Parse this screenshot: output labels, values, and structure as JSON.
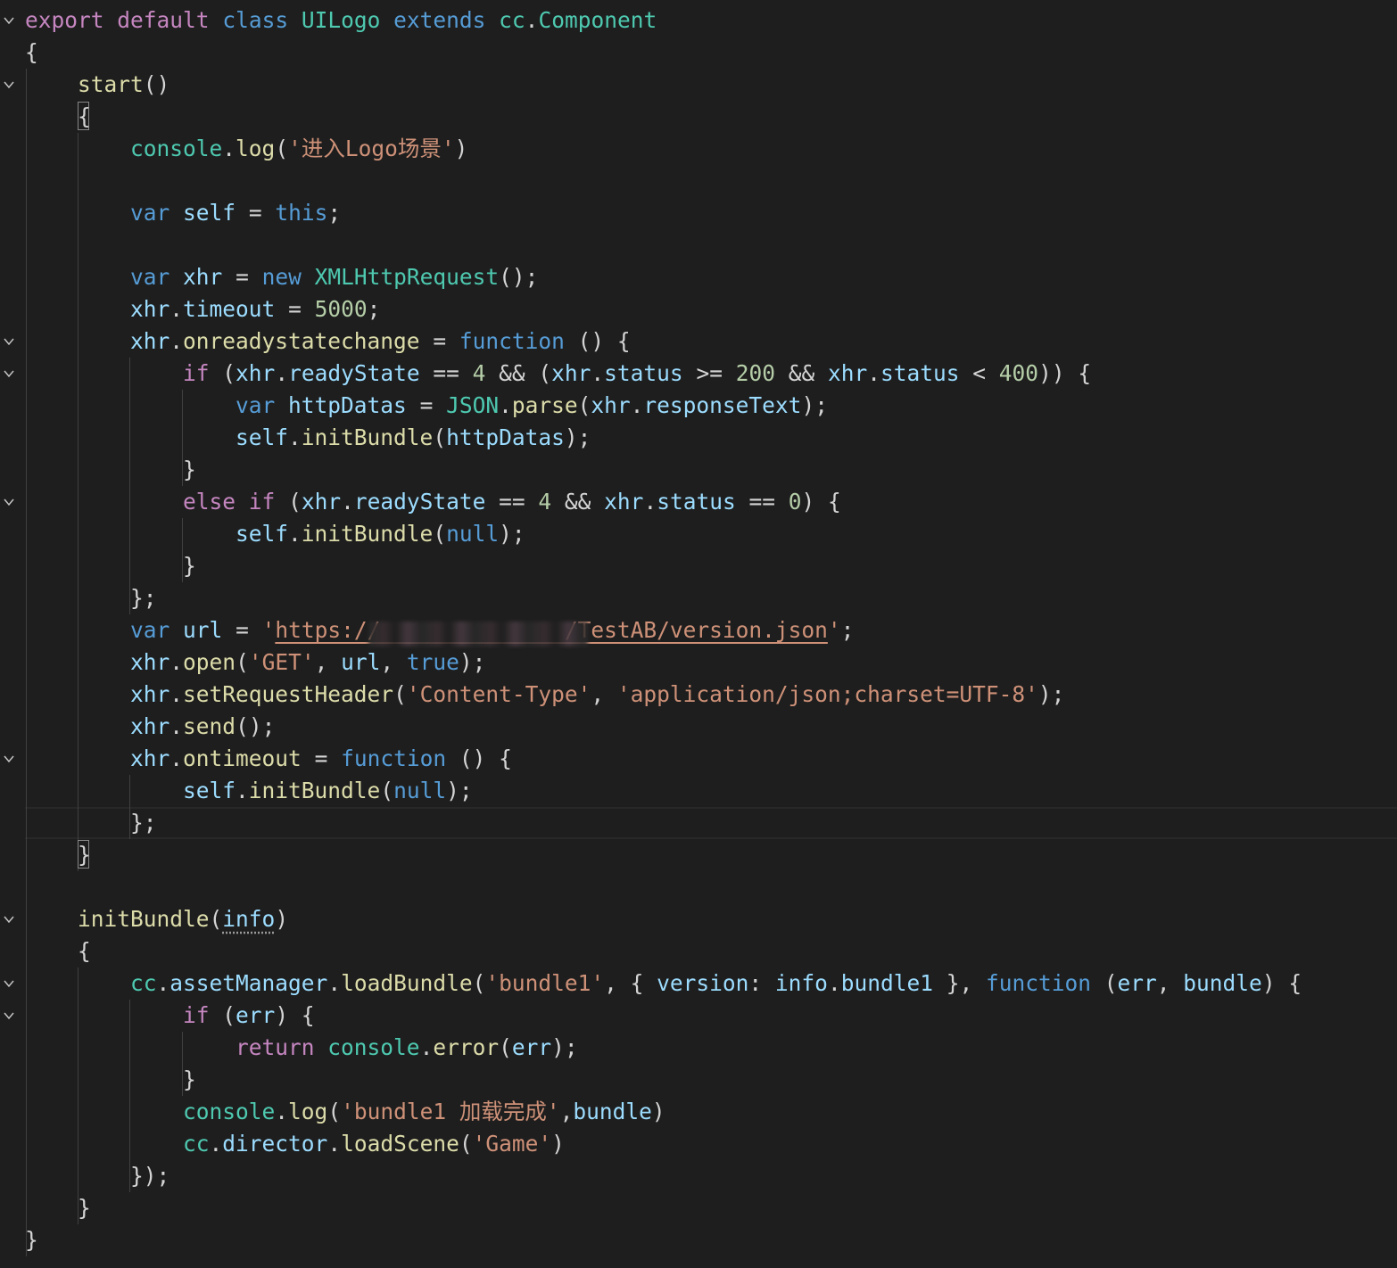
{
  "editor": {
    "background": "#1e1e1e",
    "redacted_region": "https:// host",
    "lines": [
      {
        "n": 1,
        "fold": true,
        "tokens": [
          [
            "export",
            "kw"
          ],
          [
            " ",
            "p"
          ],
          [
            "default",
            "kw"
          ],
          [
            " ",
            "p"
          ],
          [
            "class",
            "st"
          ],
          [
            " ",
            "p"
          ],
          [
            "UILogo",
            "cls"
          ],
          [
            " ",
            "p"
          ],
          [
            "extends",
            "st"
          ],
          [
            " ",
            "p"
          ],
          [
            "cc",
            "cls"
          ],
          [
            ".",
            "p"
          ],
          [
            "Component",
            "cls"
          ]
        ]
      },
      {
        "n": 2,
        "fold": false,
        "tokens": [
          [
            "{",
            "p"
          ]
        ]
      },
      {
        "n": 3,
        "fold": true,
        "tokens": [
          [
            "    ",
            "p"
          ],
          [
            "start",
            "fn"
          ],
          [
            "()",
            "p"
          ]
        ]
      },
      {
        "n": 4,
        "fold": false,
        "tokens": [
          [
            "    ",
            "p"
          ],
          [
            "{",
            "p"
          ]
        ]
      },
      {
        "n": 5,
        "fold": false,
        "tokens": [
          [
            "        ",
            "p"
          ],
          [
            "console",
            "cls"
          ],
          [
            ".",
            "p"
          ],
          [
            "log",
            "fn"
          ],
          [
            "(",
            "p"
          ],
          [
            "'进入Logo场景'",
            "str"
          ],
          [
            ")",
            "p"
          ]
        ]
      },
      {
        "n": 6,
        "fold": false,
        "tokens": []
      },
      {
        "n": 7,
        "fold": false,
        "tokens": [
          [
            "        ",
            "p"
          ],
          [
            "var",
            "st"
          ],
          [
            " ",
            "p"
          ],
          [
            "self",
            "var"
          ],
          [
            " = ",
            "p"
          ],
          [
            "this",
            "st"
          ],
          [
            ";",
            "p"
          ]
        ]
      },
      {
        "n": 8,
        "fold": false,
        "tokens": []
      },
      {
        "n": 9,
        "fold": false,
        "tokens": [
          [
            "        ",
            "p"
          ],
          [
            "var",
            "st"
          ],
          [
            " ",
            "p"
          ],
          [
            "xhr",
            "var"
          ],
          [
            " = ",
            "p"
          ],
          [
            "new",
            "st"
          ],
          [
            " ",
            "p"
          ],
          [
            "XMLHttpRequest",
            "cls"
          ],
          [
            "();",
            "p"
          ]
        ]
      },
      {
        "n": 10,
        "fold": false,
        "tokens": [
          [
            "        ",
            "p"
          ],
          [
            "xhr",
            "var"
          ],
          [
            ".",
            "p"
          ],
          [
            "timeout",
            "var"
          ],
          [
            " = ",
            "p"
          ],
          [
            "5000",
            "num"
          ],
          [
            ";",
            "p"
          ]
        ]
      },
      {
        "n": 11,
        "fold": true,
        "tokens": [
          [
            "        ",
            "p"
          ],
          [
            "xhr",
            "var"
          ],
          [
            ".",
            "p"
          ],
          [
            "onreadystatechange",
            "fn"
          ],
          [
            " = ",
            "p"
          ],
          [
            "function",
            "st"
          ],
          [
            " () {",
            "p"
          ]
        ]
      },
      {
        "n": 12,
        "fold": true,
        "tokens": [
          [
            "            ",
            "p"
          ],
          [
            "if",
            "kw"
          ],
          [
            " (",
            "p"
          ],
          [
            "xhr",
            "var"
          ],
          [
            ".",
            "p"
          ],
          [
            "readyState",
            "var"
          ],
          [
            " == ",
            "p"
          ],
          [
            "4",
            "num"
          ],
          [
            " && (",
            "p"
          ],
          [
            "xhr",
            "var"
          ],
          [
            ".",
            "p"
          ],
          [
            "status",
            "var"
          ],
          [
            " >= ",
            "p"
          ],
          [
            "200",
            "num"
          ],
          [
            " && ",
            "p"
          ],
          [
            "xhr",
            "var"
          ],
          [
            ".",
            "p"
          ],
          [
            "status",
            "var"
          ],
          [
            " < ",
            "p"
          ],
          [
            "400",
            "num"
          ],
          [
            ")) {",
            "p"
          ]
        ]
      },
      {
        "n": 13,
        "fold": false,
        "tokens": [
          [
            "                ",
            "p"
          ],
          [
            "var",
            "st"
          ],
          [
            " ",
            "p"
          ],
          [
            "httpDatas",
            "var"
          ],
          [
            " = ",
            "p"
          ],
          [
            "JSON",
            "cls"
          ],
          [
            ".",
            "p"
          ],
          [
            "parse",
            "fn"
          ],
          [
            "(",
            "p"
          ],
          [
            "xhr",
            "var"
          ],
          [
            ".",
            "p"
          ],
          [
            "responseText",
            "var"
          ],
          [
            ");",
            "p"
          ]
        ]
      },
      {
        "n": 14,
        "fold": false,
        "tokens": [
          [
            "                ",
            "p"
          ],
          [
            "self",
            "var"
          ],
          [
            ".",
            "p"
          ],
          [
            "initBundle",
            "fn"
          ],
          [
            "(",
            "p"
          ],
          [
            "httpDatas",
            "var"
          ],
          [
            ");",
            "p"
          ]
        ]
      },
      {
        "n": 15,
        "fold": false,
        "tokens": [
          [
            "            ",
            "p"
          ],
          [
            "}",
            "p"
          ]
        ]
      },
      {
        "n": 16,
        "fold": true,
        "tokens": [
          [
            "            ",
            "p"
          ],
          [
            "else",
            "kw"
          ],
          [
            " ",
            "p"
          ],
          [
            "if",
            "kw"
          ],
          [
            " (",
            "p"
          ],
          [
            "xhr",
            "var"
          ],
          [
            ".",
            "p"
          ],
          [
            "readyState",
            "var"
          ],
          [
            " == ",
            "p"
          ],
          [
            "4",
            "num"
          ],
          [
            " && ",
            "p"
          ],
          [
            "xhr",
            "var"
          ],
          [
            ".",
            "p"
          ],
          [
            "status",
            "var"
          ],
          [
            " == ",
            "p"
          ],
          [
            "0",
            "num"
          ],
          [
            ") {",
            "p"
          ]
        ]
      },
      {
        "n": 17,
        "fold": false,
        "tokens": [
          [
            "                ",
            "p"
          ],
          [
            "self",
            "var"
          ],
          [
            ".",
            "p"
          ],
          [
            "initBundle",
            "fn"
          ],
          [
            "(",
            "p"
          ],
          [
            "null",
            "st"
          ],
          [
            ");",
            "p"
          ]
        ]
      },
      {
        "n": 18,
        "fold": false,
        "tokens": [
          [
            "            ",
            "p"
          ],
          [
            "}",
            "p"
          ]
        ]
      },
      {
        "n": 19,
        "fold": false,
        "tokens": [
          [
            "        ",
            "p"
          ],
          [
            "};",
            "p"
          ]
        ]
      },
      {
        "n": 20,
        "fold": false,
        "tokens": [
          [
            "        ",
            "p"
          ],
          [
            "var",
            "st"
          ],
          [
            " ",
            "p"
          ],
          [
            "url",
            "var"
          ],
          [
            " = ",
            "p"
          ],
          [
            "'",
            "str"
          ],
          [
            "https://              ",
            "url"
          ],
          [
            "/TestAB/version.json",
            "url"
          ],
          [
            "'",
            "str"
          ],
          [
            ";",
            "p"
          ]
        ]
      },
      {
        "n": 21,
        "fold": false,
        "tokens": [
          [
            "        ",
            "p"
          ],
          [
            "xhr",
            "var"
          ],
          [
            ".",
            "p"
          ],
          [
            "open",
            "fn"
          ],
          [
            "(",
            "p"
          ],
          [
            "'GET'",
            "str"
          ],
          [
            ", ",
            "p"
          ],
          [
            "url",
            "var"
          ],
          [
            ", ",
            "p"
          ],
          [
            "true",
            "st"
          ],
          [
            ");",
            "p"
          ]
        ]
      },
      {
        "n": 22,
        "fold": false,
        "tokens": [
          [
            "        ",
            "p"
          ],
          [
            "xhr",
            "var"
          ],
          [
            ".",
            "p"
          ],
          [
            "setRequestHeader",
            "fn"
          ],
          [
            "(",
            "p"
          ],
          [
            "'Content-Type'",
            "str"
          ],
          [
            ", ",
            "p"
          ],
          [
            "'application/json;charset=UTF-8'",
            "str"
          ],
          [
            ");",
            "p"
          ]
        ]
      },
      {
        "n": 23,
        "fold": false,
        "tokens": [
          [
            "        ",
            "p"
          ],
          [
            "xhr",
            "var"
          ],
          [
            ".",
            "p"
          ],
          [
            "send",
            "fn"
          ],
          [
            "();",
            "p"
          ]
        ]
      },
      {
        "n": 24,
        "fold": true,
        "tokens": [
          [
            "        ",
            "p"
          ],
          [
            "xhr",
            "var"
          ],
          [
            ".",
            "p"
          ],
          [
            "ontimeout",
            "fn"
          ],
          [
            " = ",
            "p"
          ],
          [
            "function",
            "st"
          ],
          [
            " () {",
            "p"
          ]
        ]
      },
      {
        "n": 25,
        "fold": false,
        "tokens": [
          [
            "            ",
            "p"
          ],
          [
            "self",
            "var"
          ],
          [
            ".",
            "p"
          ],
          [
            "initBundle",
            "fn"
          ],
          [
            "(",
            "p"
          ],
          [
            "null",
            "st"
          ],
          [
            ");",
            "p"
          ]
        ]
      },
      {
        "n": 26,
        "fold": false,
        "tokens": [
          [
            "        ",
            "p"
          ],
          [
            "};",
            "p"
          ]
        ]
      },
      {
        "n": 27,
        "fold": false,
        "tokens": [
          [
            "    ",
            "p"
          ],
          [
            "}",
            "p"
          ]
        ]
      },
      {
        "n": 28,
        "fold": false,
        "tokens": []
      },
      {
        "n": 29,
        "fold": true,
        "tokens": [
          [
            "    ",
            "p"
          ],
          [
            "initBundle",
            "fn"
          ],
          [
            "(",
            "p"
          ],
          [
            "info",
            "dots"
          ],
          [
            ")",
            "p"
          ]
        ]
      },
      {
        "n": 30,
        "fold": false,
        "tokens": [
          [
            "    ",
            "p"
          ],
          [
            "{",
            "p"
          ]
        ]
      },
      {
        "n": 31,
        "fold": true,
        "tokens": [
          [
            "        ",
            "p"
          ],
          [
            "cc",
            "cls"
          ],
          [
            ".",
            "p"
          ],
          [
            "assetManager",
            "var"
          ],
          [
            ".",
            "p"
          ],
          [
            "loadBundle",
            "fn"
          ],
          [
            "(",
            "p"
          ],
          [
            "'bundle1'",
            "str"
          ],
          [
            ", { ",
            "p"
          ],
          [
            "version",
            "var"
          ],
          [
            ": ",
            "p"
          ],
          [
            "info",
            "var"
          ],
          [
            ".",
            "p"
          ],
          [
            "bundle1",
            "var"
          ],
          [
            " }, ",
            "p"
          ],
          [
            "function",
            "st"
          ],
          [
            " (",
            "p"
          ],
          [
            "err",
            "var"
          ],
          [
            ", ",
            "p"
          ],
          [
            "bundle",
            "var"
          ],
          [
            ") {",
            "p"
          ]
        ]
      },
      {
        "n": 32,
        "fold": true,
        "tokens": [
          [
            "            ",
            "p"
          ],
          [
            "if",
            "kw"
          ],
          [
            " (",
            "p"
          ],
          [
            "err",
            "var"
          ],
          [
            ") {",
            "p"
          ]
        ]
      },
      {
        "n": 33,
        "fold": false,
        "tokens": [
          [
            "                ",
            "p"
          ],
          [
            "return",
            "kw"
          ],
          [
            " ",
            "p"
          ],
          [
            "console",
            "cls"
          ],
          [
            ".",
            "p"
          ],
          [
            "error",
            "fn"
          ],
          [
            "(",
            "p"
          ],
          [
            "err",
            "var"
          ],
          [
            ");",
            "p"
          ]
        ]
      },
      {
        "n": 34,
        "fold": false,
        "tokens": [
          [
            "            ",
            "p"
          ],
          [
            "}",
            "p"
          ]
        ]
      },
      {
        "n": 35,
        "fold": false,
        "tokens": [
          [
            "            ",
            "p"
          ],
          [
            "console",
            "cls"
          ],
          [
            ".",
            "p"
          ],
          [
            "log",
            "fn"
          ],
          [
            "(",
            "p"
          ],
          [
            "'bundle1 加载完成'",
            "str"
          ],
          [
            ",",
            "p"
          ],
          [
            "bundle",
            "var"
          ],
          [
            ")",
            "p"
          ]
        ]
      },
      {
        "n": 36,
        "fold": false,
        "tokens": [
          [
            "            ",
            "p"
          ],
          [
            "cc",
            "cls"
          ],
          [
            ".",
            "p"
          ],
          [
            "director",
            "var"
          ],
          [
            ".",
            "p"
          ],
          [
            "loadScene",
            "fn"
          ],
          [
            "(",
            "p"
          ],
          [
            "'Game'",
            "str"
          ],
          [
            ")",
            "p"
          ]
        ]
      },
      {
        "n": 37,
        "fold": false,
        "tokens": [
          [
            "        ",
            "p"
          ],
          [
            "});",
            "p"
          ]
        ]
      },
      {
        "n": 38,
        "fold": false,
        "tokens": [
          [
            "    ",
            "p"
          ],
          [
            "}",
            "p"
          ]
        ]
      },
      {
        "n": 39,
        "fold": false,
        "tokens": [
          [
            "}",
            "p"
          ]
        ]
      }
    ]
  }
}
